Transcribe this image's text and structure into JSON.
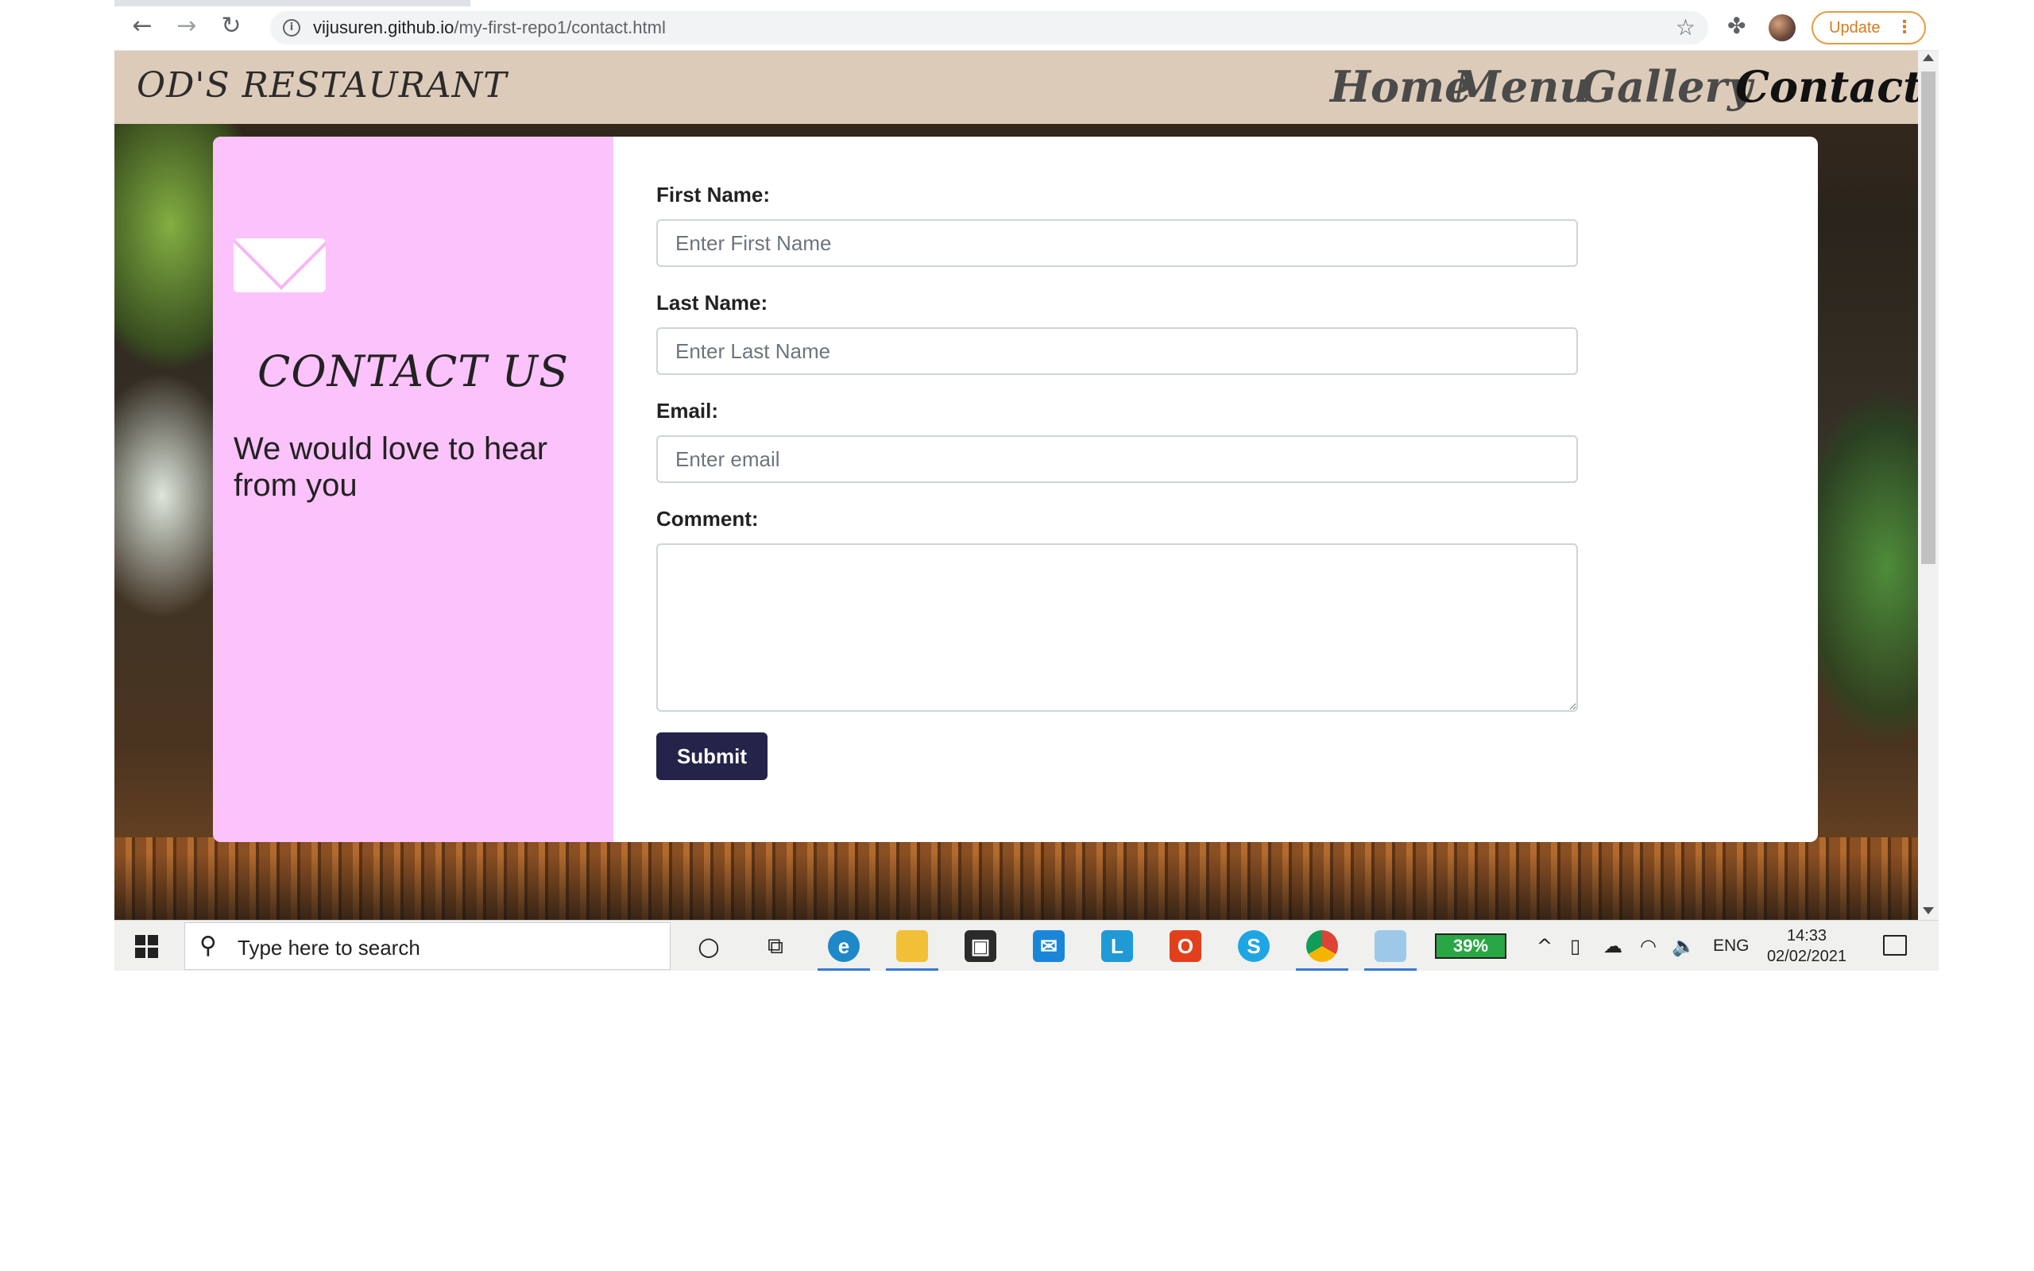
{
  "browser": {
    "url_host": "vijusuren.github.io",
    "url_path": "/my-first-repo1/contact.html",
    "update_label": "Update"
  },
  "site": {
    "brand": "OD'S RESTAURANT",
    "nav": [
      "Home",
      "Menu",
      "Gallery",
      "Contact"
    ],
    "active_nav": "Contact"
  },
  "contact": {
    "heading": "CONTACT US",
    "subheading": "We would love to hear from you",
    "form": {
      "first_name_label": "First Name:",
      "first_name_placeholder": "Enter First Name",
      "last_name_label": "Last Name:",
      "last_name_placeholder": "Enter Last Name",
      "email_label": "Email:",
      "email_placeholder": "Enter email",
      "comment_label": "Comment:",
      "submit_label": "Submit"
    }
  },
  "taskbar": {
    "search_placeholder": "Type here to search",
    "battery": "39%",
    "language": "ENG",
    "time": "14:33",
    "date": "02/02/2021"
  },
  "colors": {
    "nav_bg": "#dccbb8",
    "side_panel": "#fcc2fb",
    "submit_bg": "#24234a",
    "update_accent": "#e69b3d"
  }
}
